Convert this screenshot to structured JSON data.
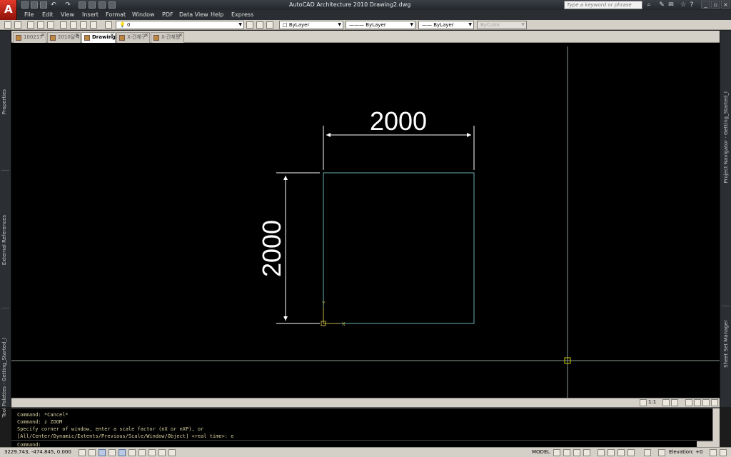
{
  "window": {
    "title": "AutoCAD Architecture 2010    Drawing2.dwg",
    "search_placeholder": "Type a keyword or phrase"
  },
  "menu": [
    "File",
    "Edit",
    "View",
    "Insert",
    "Format",
    "Window",
    "PDF",
    "Data View",
    "Help",
    "Express"
  ],
  "toolbar": {
    "layer": "0",
    "color": "ByLayer",
    "linetype": "ByLayer",
    "lineweight": "ByLayer",
    "plotstyle": "ByColor"
  },
  "tabs": [
    {
      "label": "100217"
    },
    {
      "label": "2010달력"
    },
    {
      "label": "Drawing2..."
    },
    {
      "label": "X-간체구"
    },
    {
      "label": "X-간체평"
    }
  ],
  "left_palettes": [
    "Properties",
    "External References",
    "Tool Palettes - Getting_Started_I"
  ],
  "right_palettes": [
    "Project Navigator - Getting_Started_I",
    "Sheet Set Manager"
  ],
  "drawing": {
    "dim_horizontal": "2000",
    "dim_vertical": "2000",
    "ucs_x": "X",
    "ucs_y": "Y"
  },
  "annotation_scale": "1:1",
  "command": {
    "history": [
      "Command: *Cancel*",
      "Command: z ZOOM",
      "Specify corner of window, enter a scale factor (nX or nXP), or",
      "[All/Center/Dynamic/Extents/Previous/Scale/Window/Object] <real time>: e"
    ],
    "prompt": "Command:"
  },
  "status": {
    "coords": "3229.743, -474.845, 0.000",
    "model": "MODEL",
    "elevation": "Elevation: +0"
  },
  "colors": {
    "canvas_bg": "#000000",
    "rect": "#6ab0b0",
    "crosshair": "#8c9a8c",
    "dim": "#ffffff"
  }
}
